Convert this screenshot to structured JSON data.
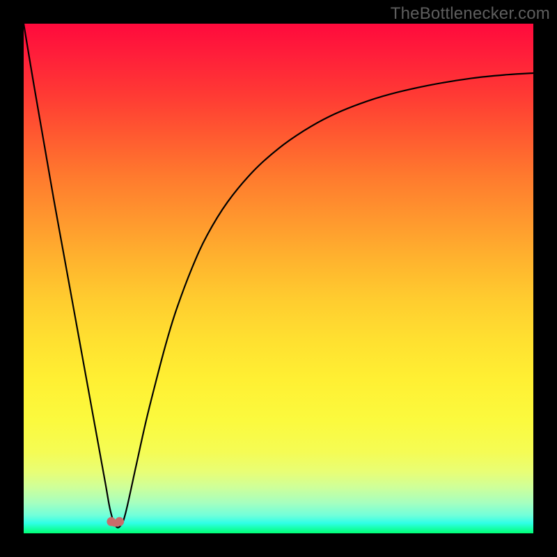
{
  "watermark": {
    "text": "TheBottlenecker.com"
  },
  "colors": {
    "page_bg": "#000000",
    "curve_stroke": "#000000",
    "marker_fill": "#c96b6b",
    "gradient_top": "#ff0a3c",
    "gradient_bottom": "#00ff74"
  },
  "chart_data": {
    "type": "line",
    "title": "",
    "xlabel": "",
    "ylabel": "",
    "xlim": [
      0,
      100
    ],
    "ylim": [
      0,
      100
    ],
    "grid": false,
    "legend": false,
    "series": [
      {
        "name": "bottleneck-curve",
        "x": [
          0,
          2,
          4,
          6,
          8,
          10,
          12,
          14,
          16,
          17,
          18,
          19,
          20,
          22,
          24,
          26,
          28,
          30,
          33,
          36,
          40,
          45,
          50,
          55,
          60,
          66,
          72,
          80,
          88,
          95,
          100
        ],
        "y": [
          100,
          88,
          76.5,
          65,
          54,
          43,
          32,
          21,
          10,
          4.5,
          1.5,
          1.5,
          4,
          13,
          22,
          30,
          37.5,
          44,
          52,
          58.5,
          65,
          71,
          75.5,
          79,
          81.8,
          84.3,
          86.2,
          88,
          89.3,
          90,
          90.3
        ]
      }
    ],
    "markers": [
      {
        "name": "valley-left",
        "x": 17.2,
        "y": 2.3
      },
      {
        "name": "valley-right",
        "x": 18.8,
        "y": 2.3
      }
    ],
    "annotations": []
  }
}
